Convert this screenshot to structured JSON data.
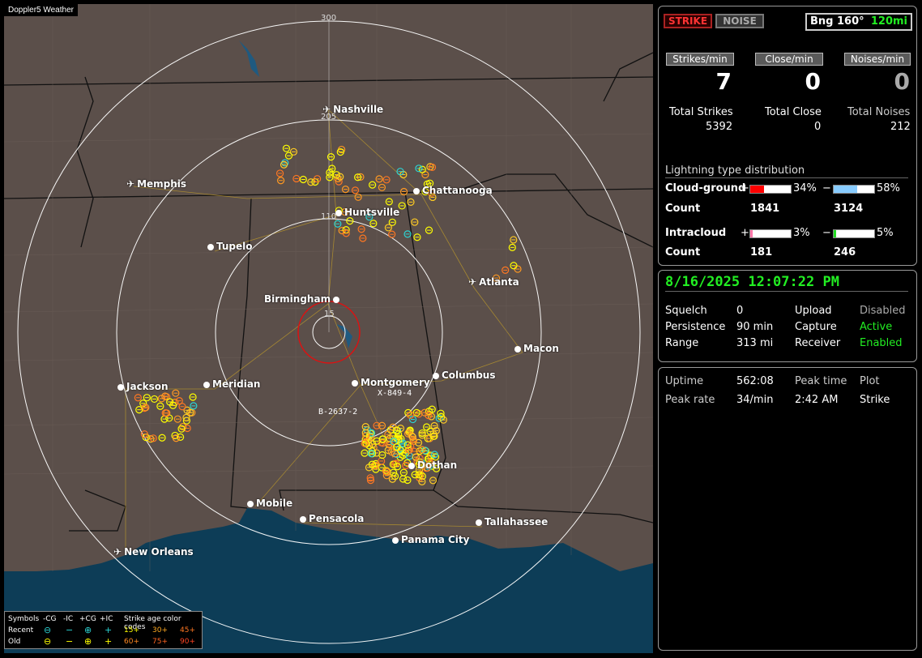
{
  "app": {
    "title": "Doppler5 Weather"
  },
  "map": {
    "range_labels": [
      "300",
      "205",
      "110",
      "15"
    ],
    "cities": [
      {
        "name": "Nashville",
        "kind": "airport"
      },
      {
        "name": "Memphis",
        "kind": "airport"
      },
      {
        "name": "Chattanooga",
        "kind": "city"
      },
      {
        "name": "Huntsville",
        "kind": "city"
      },
      {
        "name": "Tupelo",
        "kind": "city"
      },
      {
        "name": "Atlanta",
        "kind": "airport"
      },
      {
        "name": "Birmingham",
        "kind": "city"
      },
      {
        "name": "Macon",
        "kind": "city"
      },
      {
        "name": "Jackson",
        "kind": "city"
      },
      {
        "name": "Meridian",
        "kind": "city"
      },
      {
        "name": "Montgomery",
        "kind": "city"
      },
      {
        "name": "Columbus",
        "kind": "city"
      },
      {
        "name": "Dothan",
        "kind": "city"
      },
      {
        "name": "Mobile",
        "kind": "city"
      },
      {
        "name": "Pensacola",
        "kind": "city"
      },
      {
        "name": "Tallahassee",
        "kind": "city"
      },
      {
        "name": "Panama City",
        "kind": "city"
      },
      {
        "name": "New Orleans",
        "kind": "airport"
      }
    ],
    "storm_labels": [
      "X-849-4",
      "B-2637-2"
    ]
  },
  "legend": {
    "symbols_label": "Symbols",
    "headers": [
      "-CG",
      "-IC",
      "+CG",
      "+IC"
    ],
    "age_label": "Strike age color codes",
    "recent_label": "Recent",
    "old_label": "Old",
    "recent_ages": [
      "15+",
      "30+",
      "45+"
    ],
    "old_ages": [
      "60+",
      "75+",
      "90+"
    ]
  },
  "top": {
    "strike_btn": "STRIKE",
    "noise_btn": "NOISE",
    "bearing": "Bng 160°",
    "range": "120mi",
    "strikes_min_label": "Strikes/min",
    "close_min_label": "Close/min",
    "noises_min_label": "Noises/min",
    "strikes_min": "7",
    "close_min": "0",
    "noises_min": "0",
    "total_strikes_label": "Total Strikes",
    "total_close_label": "Total Close",
    "total_noises_label": "Total Noises",
    "total_strikes": "5392",
    "total_close": "0",
    "total_noises": "212",
    "dist_label": "Lightning type distribution",
    "cg_label": "Cloud-ground",
    "ic_label": "Intracloud",
    "count_label": "Count",
    "plus": "+",
    "minus": "−",
    "cg_pos_pct": "34%",
    "cg_neg_pct": "58%",
    "cg_pos_count": "1841",
    "cg_neg_count": "3124",
    "ic_pos_pct": "3%",
    "ic_neg_pct": "5%",
    "ic_pos_count": "181",
    "ic_neg_count": "246",
    "cg_pos_fill": 0.34,
    "cg_neg_fill": 0.58,
    "ic_pos_fill": 0.03,
    "ic_neg_fill": 0.05,
    "colors": {
      "cg_pos": "#ff0000",
      "cg_neg": "#88ccff",
      "ic_pos": "#ff77aa",
      "ic_neg": "#22dd22"
    }
  },
  "status": {
    "datetime": "8/16/2025 12:07:22 PM",
    "squelch_label": "Squelch",
    "squelch": "0",
    "upload_label": "Upload",
    "upload": "Disabled",
    "persistence_label": "Persistence",
    "persistence": "90 min",
    "capture_label": "Capture",
    "capture": "Active",
    "range_label": "Range",
    "range": "313 mi",
    "receiver_label": "Receiver",
    "receiver": "Enabled"
  },
  "stats": {
    "uptime_label": "Uptime",
    "uptime": "562:08",
    "peak_time_label": "Peak time",
    "peak_time": "2:42 AM",
    "plot_label": "Plot",
    "plot": "Strike",
    "peak_rate_label": "Peak rate",
    "peak_rate": "34/min"
  }
}
